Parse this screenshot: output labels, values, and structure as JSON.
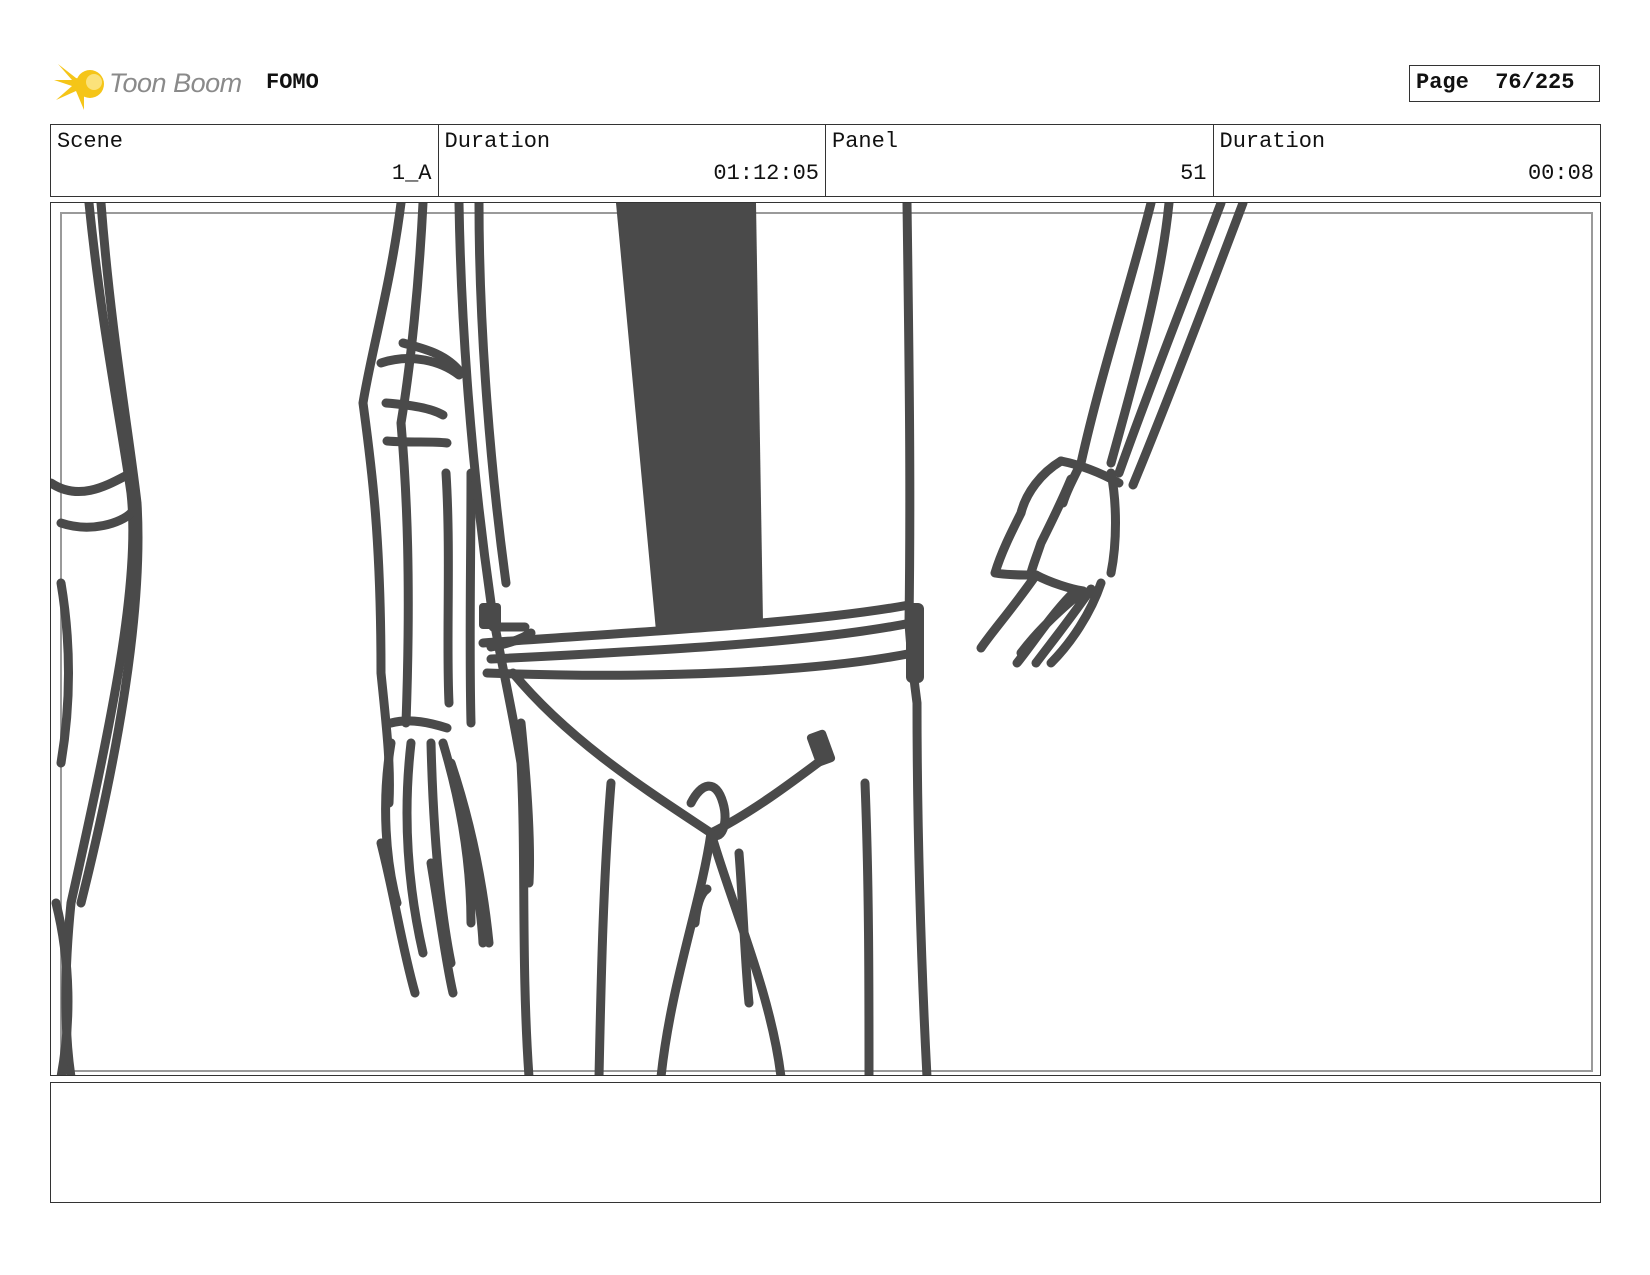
{
  "header": {
    "logo_text": "Toon Boom",
    "project": "FOMO",
    "page_label": "Page",
    "page_value": "76/225"
  },
  "info": {
    "scene_label": "Scene",
    "scene_value": "1_A",
    "duration_label": "Duration",
    "duration_value": "01:12:05",
    "panel_label": "Panel",
    "panel_value": "51",
    "panel_duration_label": "Duration",
    "panel_duration_value": "00:08"
  },
  "notes": {
    "text": ""
  },
  "colors": {
    "sketch": "#4a4a4a",
    "logo_yellow": "#f5c518",
    "border": "#333333"
  }
}
